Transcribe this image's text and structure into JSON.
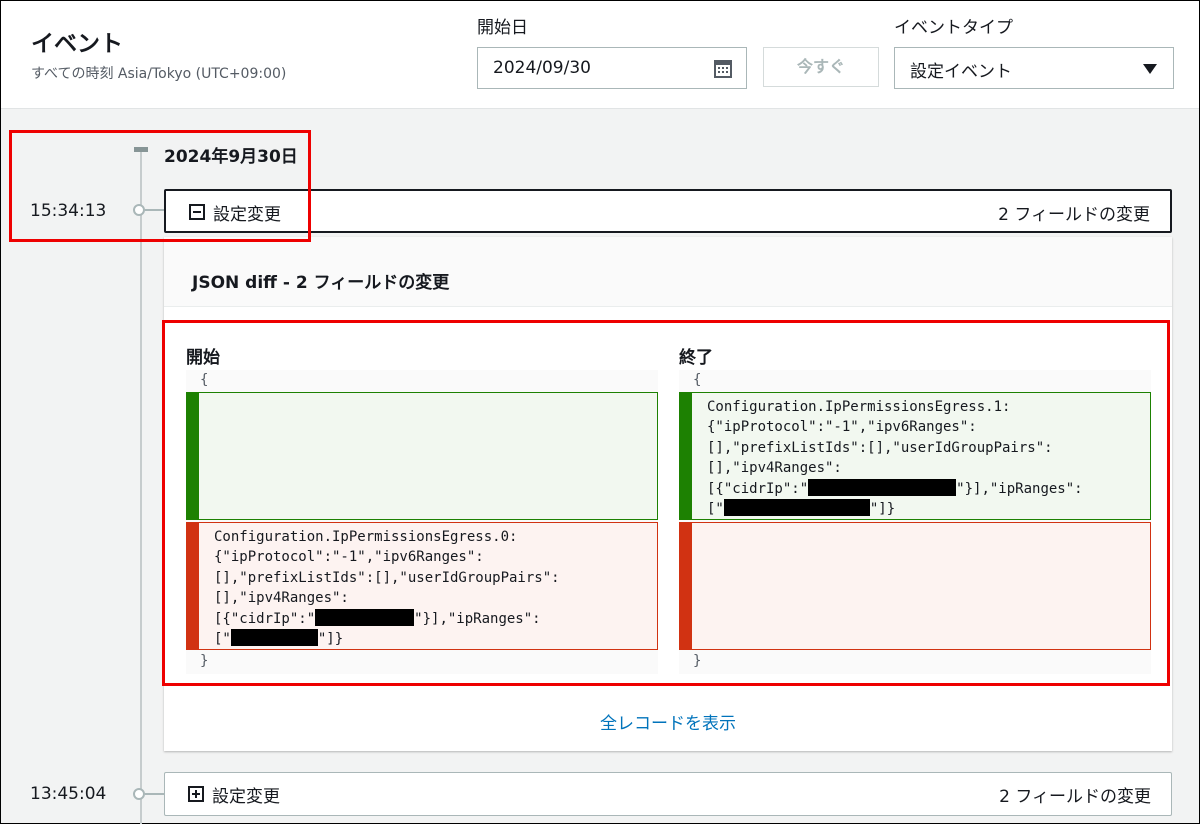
{
  "header": {
    "title": "イベント",
    "subtitle": "すべての時刻 Asia/Tokyo (UTC+09:00)",
    "start_date_label": "開始日",
    "start_date_value": "2024/09/30",
    "now_button": "今すぐ",
    "event_type_label": "イベントタイプ",
    "event_type_value": "設定イベント"
  },
  "timeline": {
    "date_heading": "2024年9月30日",
    "events": [
      {
        "time": "15:34:13",
        "label": "設定変更",
        "changes": "2 フィールドの変更",
        "expanded": true
      },
      {
        "time": "13:45:04",
        "label": "設定変更",
        "changes": "2 フィールドの変更",
        "expanded": false
      }
    ]
  },
  "diff": {
    "title": "JSON diff - 2 フィールドの変更",
    "from_title": "開始",
    "to_title": "終了",
    "open_brace": "{",
    "close_brace": "}",
    "from_removed": {
      "line1": "Configuration.IpPermissionsEgress.0:",
      "line2": "{\"ipProtocol\":\"-1\",\"ipv6Ranges\":",
      "line3": "[],\"prefixListIds\":[],\"userIdGroupPairs\":",
      "line4": "[],\"ipv4Ranges\":",
      "line5_pre": "[{\"cidrIp\":\"",
      "line5_post": "\"}],\"ipRanges\":",
      "line6_pre": "[\"",
      "line6_post": "\"]}"
    },
    "to_added": {
      "line1": "Configuration.IpPermissionsEgress.1:",
      "line2": "{\"ipProtocol\":\"-1\",\"ipv6Ranges\":",
      "line3": "[],\"prefixListIds\":[],\"userIdGroupPairs\":",
      "line4": "[],\"ipv4Ranges\":",
      "line5_pre": "[{\"cidrIp\":\"",
      "line5_post": "\"}],\"ipRanges\":",
      "line6_pre": "[\"",
      "line6_post": "\"]}"
    },
    "show_all_link": "全レコードを表示"
  },
  "icons": {
    "calendar": "calendar-icon",
    "dropdown": "caret-down-icon",
    "collapse": "minus-square-icon",
    "expand": "plus-square-icon"
  },
  "colors": {
    "added": "#1d8102",
    "removed": "#d13212",
    "link": "#0073bb",
    "highlight": "#ee0000"
  }
}
